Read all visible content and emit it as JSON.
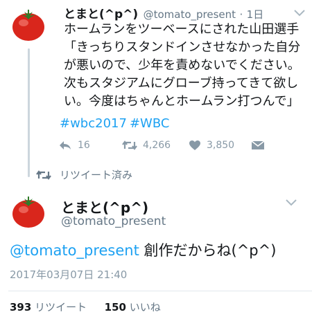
{
  "retweeted_tweet": {
    "name": "とまと(^p^)",
    "handle": "@tomato_present",
    "separator": "·",
    "time": "1日",
    "text": "ホームランをツーベースにされた山田選手「きっちりスタンドインさせなかった自分が悪いので、少年を責めないでください。次もスタジアムにグローブ持ってきて欲しい。今度はちゃんとホームラン打つんで」",
    "hashtags": [
      "#wbc2017",
      "#WBC"
    ],
    "actions": {
      "reply_count": "16",
      "retweet_count": "4,266",
      "like_count": "3,850"
    },
    "icons": [
      "reply-icon",
      "retweet-icon",
      "like-icon",
      "direct-message-icon",
      "chevron-down-icon"
    ]
  },
  "retweet_status": {
    "label": "リツイート済み",
    "icon": "retweet-icon"
  },
  "main_tweet": {
    "name": "とまと(^p^)",
    "handle": "@tomato_present",
    "mention": "@tomato_present",
    "text": " 創作だからね(^p^)",
    "timestamp": "2017年03月07日 21:40",
    "stats": {
      "retweets_count": "393",
      "retweets_label": "リツイート",
      "likes_count": "150",
      "likes_label": "いいね"
    }
  },
  "colors": {
    "link": "#1da1f2",
    "secondary_text": "#657786",
    "icon_gray": "#8899a6",
    "tomato_red": "#d9261c"
  }
}
